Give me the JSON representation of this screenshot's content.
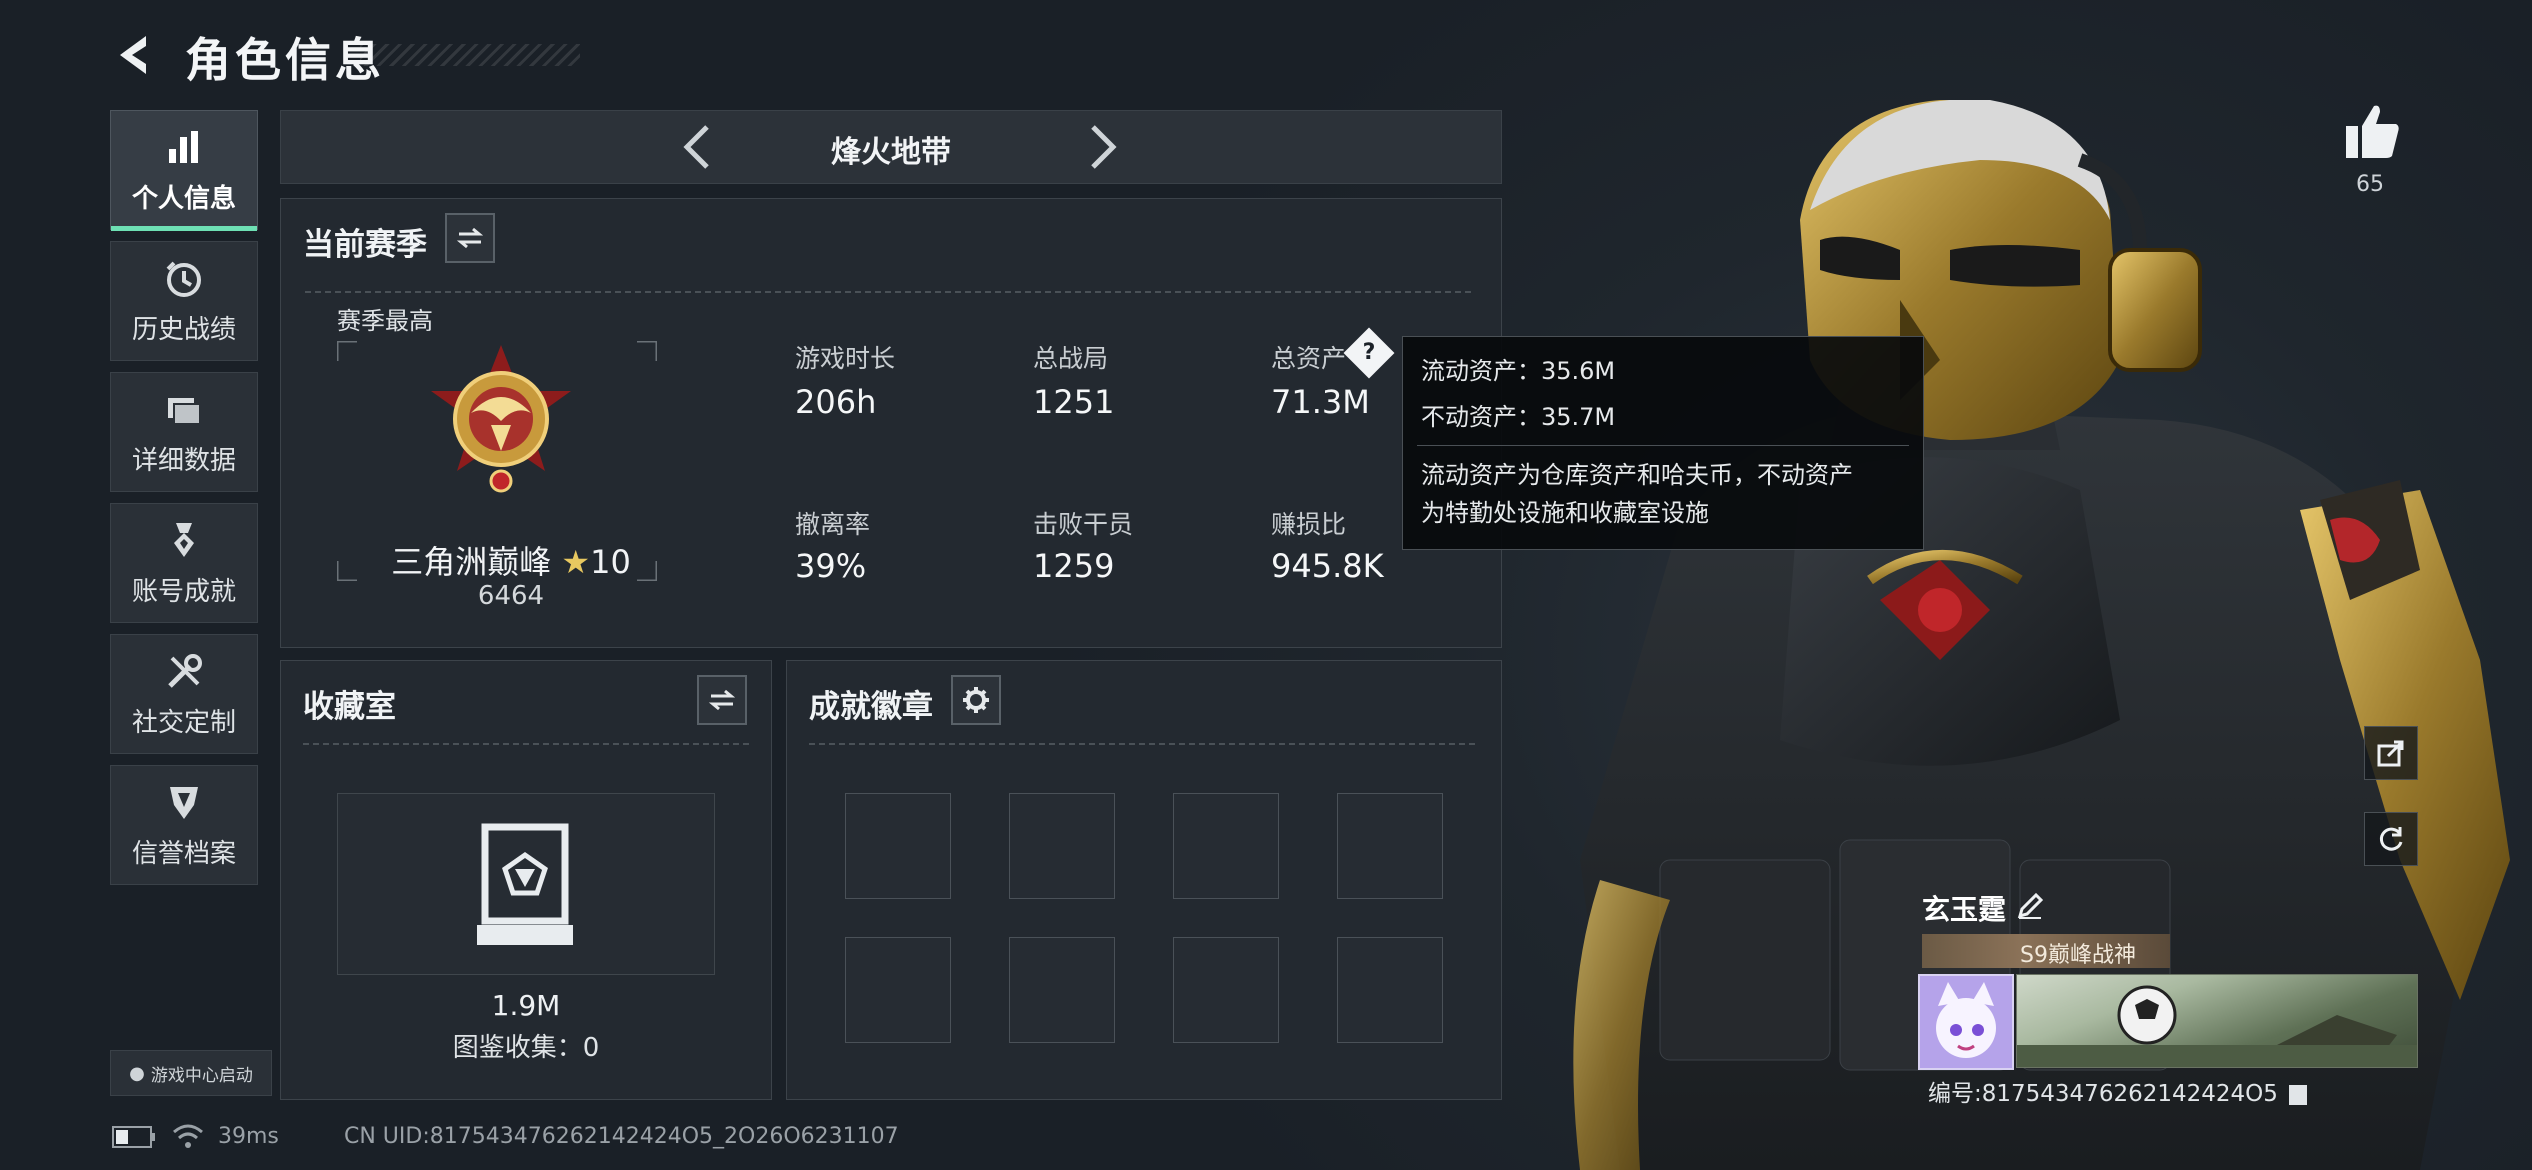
{
  "header": {
    "title": "角色信息"
  },
  "sidebar": {
    "items": [
      {
        "label": "个人信息",
        "icon": "bar-chart-icon",
        "active": true
      },
      {
        "label": "历史战绩",
        "icon": "history-clock-icon",
        "active": false
      },
      {
        "label": "详细数据",
        "icon": "folder-icon",
        "active": false
      },
      {
        "label": "账号成就",
        "icon": "achievement-medal-icon",
        "active": false
      },
      {
        "label": "社交定制",
        "icon": "tools-icon",
        "active": false
      },
      {
        "label": "信誉档案",
        "icon": "shield-emblem-icon",
        "active": false
      }
    ],
    "launch_label": "游戏中心启动"
  },
  "mode_selector": {
    "name": "烽火地带"
  },
  "season": {
    "title": "当前赛季",
    "best_label": "赛季最高",
    "rank_name": "三角洲巅峰",
    "rank_stars": "10",
    "rank_score": "6464",
    "stats": [
      {
        "label": "游戏时长",
        "value": "206h"
      },
      {
        "label": "总战局",
        "value": "1251"
      },
      {
        "label": "总资产",
        "value": "71.3M"
      },
      {
        "label": "撤离率",
        "value": "39%"
      },
      {
        "label": "击败干员",
        "value": "1259"
      },
      {
        "label": "赚损比",
        "value": "945.8K"
      }
    ]
  },
  "tooltip": {
    "liquid": "流动资产：35.6M",
    "fixed": "不动资产：35.7M",
    "desc_line1": "流动资产为仓库资产和哈夫币，不动资产",
    "desc_line2": "为特勤处设施和收藏室设施"
  },
  "collection": {
    "title": "收藏室",
    "value": "1.9M",
    "catalog": "图鉴收集：0"
  },
  "badges": {
    "title": "成就徽章",
    "slots": 8
  },
  "status_bar": {
    "ping": "39ms",
    "uid": "CN UID:817543476262142424O5_2O26O6231107"
  },
  "profile": {
    "likes": "65",
    "player_name": "玄玉霆",
    "player_title": "S9巅峰战神",
    "id_text": "编号:817543476262142424O5"
  },
  "colors": {
    "accent": "#6ee0b4",
    "background": "#1b2128",
    "panel": "#232930"
  }
}
